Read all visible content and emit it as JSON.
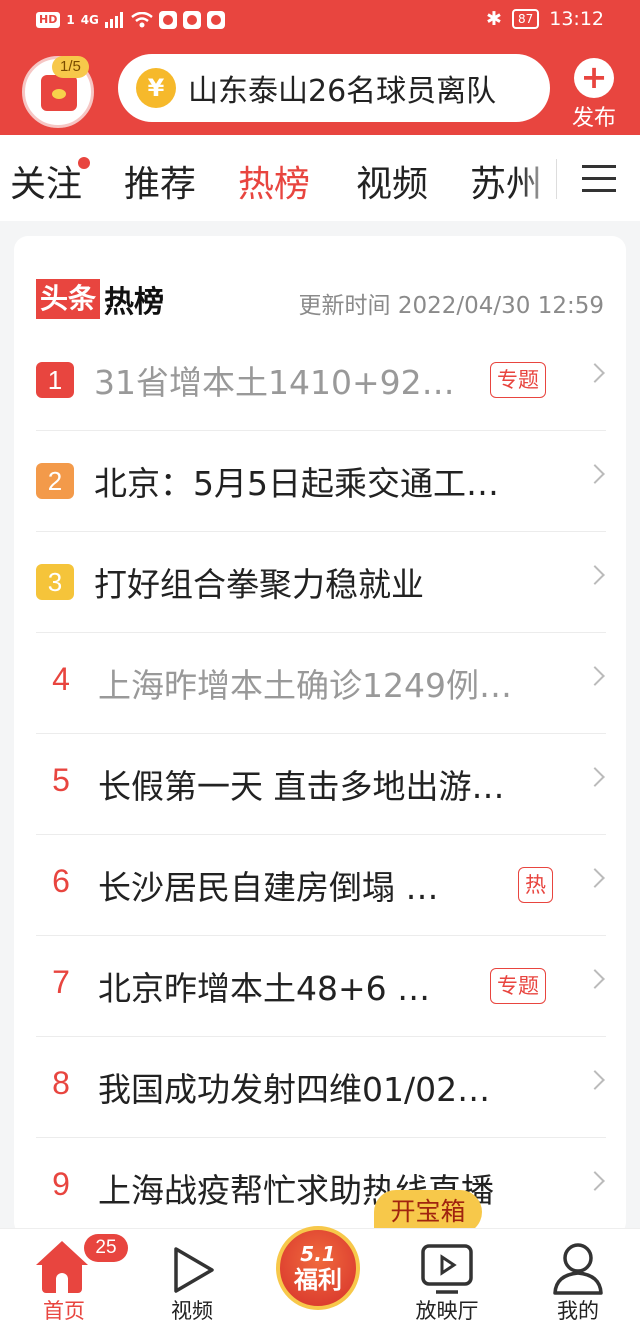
{
  "status_bar": {
    "network_labels": [
      "HD",
      "1",
      "4G"
    ],
    "battery": "87",
    "time": "13:12"
  },
  "header": {
    "counter": "1/5",
    "search_coin": "¥",
    "search_text": "山东泰山26名球员离队",
    "publish_label": "发布"
  },
  "tabs": [
    {
      "label": "关注",
      "has_dot": true
    },
    {
      "label": "推荐"
    },
    {
      "label": "热榜",
      "active": true
    },
    {
      "label": "视频"
    },
    {
      "label": "苏州"
    }
  ],
  "hot_list": {
    "brand_part1": "头条",
    "brand_part2": "热榜",
    "updated": "更新时间 2022/04/30 12:59",
    "items": [
      {
        "rank": "1",
        "title": "31省增本土1410+92…",
        "tag": "专题",
        "rank_color": "#e8453f"
      },
      {
        "rank": "2",
        "title": "北京：5月5日起乘交通工…",
        "rank_color": "#f39a4a"
      },
      {
        "rank": "3",
        "title": "打好组合拳聚力稳就业",
        "rank_color": "#f5c43a"
      },
      {
        "rank": "4",
        "title": "上海昨增本土确诊1249例…"
      },
      {
        "rank": "5",
        "title": "长假第一天 直击多地出游…"
      },
      {
        "rank": "6",
        "title": "长沙居民自建房倒塌 …",
        "tag": "热"
      },
      {
        "rank": "7",
        "title": "北京昨增本土48+6 …",
        "tag": "专题"
      },
      {
        "rank": "8",
        "title": "我国成功发射四维01/02…"
      },
      {
        "rank": "9",
        "title": "上海战疫帮忙求助热线直播"
      }
    ]
  },
  "treasure": "开宝箱",
  "bottom_nav": {
    "home": "首页",
    "home_badge": "25",
    "video": "视频",
    "welfare_line1": "5.1",
    "welfare_line2": "福利",
    "theater": "放映厅",
    "me": "我的"
  },
  "colors": {
    "accent": "#e8453f",
    "gold": "#f7c84a"
  }
}
